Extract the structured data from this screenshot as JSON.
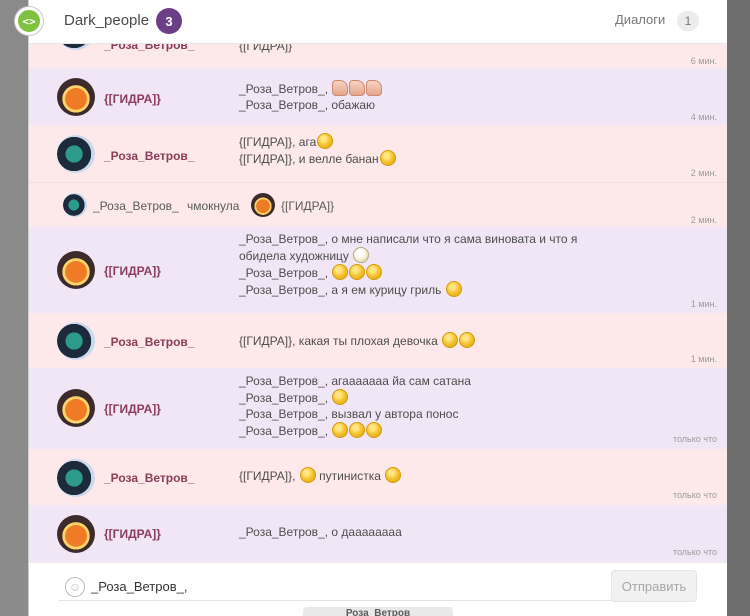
{
  "header": {
    "title": "Dark_people",
    "title_badge": "3",
    "dialogs_label": "Диалоги",
    "dialogs_badge": "1"
  },
  "messages": [
    {
      "author": "_Роза_Ветров_",
      "partial_text": "{[ГИДРА]}",
      "time": "6 мин."
    },
    {
      "author": "{[ГИДРА]}",
      "lines": [
        "_Роза_Ветров_,",
        "_Роза_Ветров_, обажаю"
      ],
      "time": "4 мин."
    },
    {
      "author": "_Роза_Ветров_",
      "lines": [
        "{[ГИДРА]}, ага",
        "{[ГИДРА]}, и велле банан"
      ],
      "time": "2 мин."
    },
    {
      "author": "_Роза_Ветров_",
      "action": "чмокнула",
      "target": "{[ГИДРА]}",
      "time": "2 мин."
    },
    {
      "author": "{[ГИДРА]}",
      "lines": [
        "_Роза_Ветров_, о мне написали что я сама виновата и что я",
        "обидела художницу",
        "_Роза_Ветров_,",
        "_Роза_Ветров_, а я ем курицу гриль"
      ],
      "time": "1 мин."
    },
    {
      "author": "_Роза_Ветров_",
      "lines": [
        "{[ГИДРА]}, какая ты плохая девочка"
      ],
      "time": "1 мин."
    },
    {
      "author": "{[ГИДРА]}",
      "lines": [
        "_Роза_Ветров_, агааааааа йа сам сатана",
        "_Роза_Ветров_,",
        "_Роза_Ветров_, вызвал у автора понос",
        "_Роза_Ветров_,"
      ],
      "time": "только что"
    },
    {
      "author": "_Роза_Ветров_",
      "lines": [
        "{[ГИДРА]},",
        "путинистка"
      ],
      "time": "только что"
    },
    {
      "author": "{[ГИДРА]}",
      "lines": [
        "_Роза_Ветров_, о даааааааа"
      ],
      "time": "только что"
    }
  ],
  "input": {
    "value": "_Роза_Ветров_,",
    "send_label": "Отправить"
  },
  "bottom_tab": "_Роза_Ветров_"
}
